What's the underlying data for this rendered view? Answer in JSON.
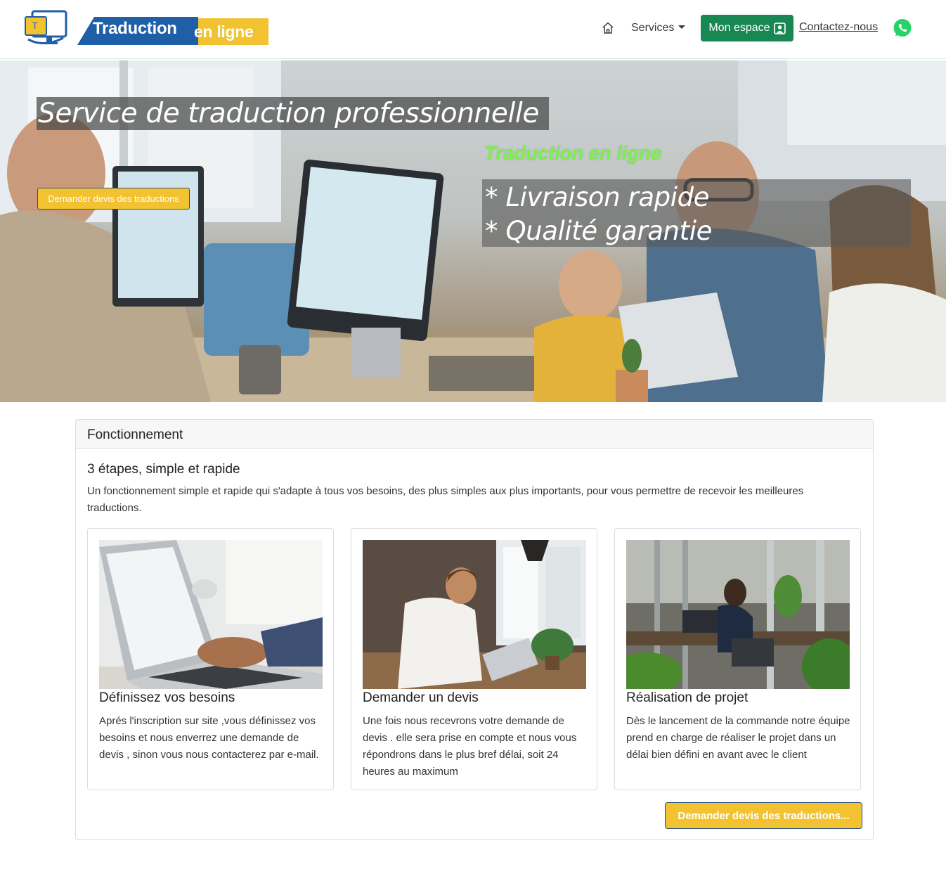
{
  "header": {
    "logo": {
      "text_main": "Traduction",
      "text_accent": "en ligne"
    },
    "nav": {
      "home_icon": "home-icon",
      "services_label": "Services",
      "espace_label": "Mon espace",
      "espace_icon": "user-square-icon",
      "contact_label": "Contactez-nous",
      "whatsapp_icon": "whatsapp-icon"
    }
  },
  "hero": {
    "title": "Service de traduction professionnelle",
    "button_label": "Demander devis des traductions",
    "subtitle": "Traduction en ligne",
    "features": [
      "* Livraison rapide",
      "* Qualité garantie"
    ]
  },
  "main": {
    "card_header": "Fonctionnement",
    "section_title": "3 étapes, simple et rapide",
    "section_description": "Un fonctionnement simple et rapide qui s'adapte à tous vos besoins, des plus simples aux plus importants, pour vous permettre de recevoir les meilleures traductions.",
    "steps": [
      {
        "title": "Définissez vos besoins",
        "text": "Aprés l'inscription sur site ,vous définissez vos besoins et nous enverrez une demande de devis , sinon vous nous contacterez par e-mail."
      },
      {
        "title": "Demander un devis",
        "text": "Une fois nous recevrons votre demande de devis . elle sera prise en compte et nous vous répondrons dans le plus bref délai, soit 24 heures au maximum"
      },
      {
        "title": "Réalisation de projet",
        "text": "Dès le lancement de la commande notre équipe prend en charge de réaliser le projet dans un délai bien défini en avant avec le client"
      }
    ],
    "cta_label": "Demander devis des traductions..."
  },
  "colors": {
    "brand_blue": "#1f5fa8",
    "brand_yellow": "#f2c230",
    "success_green": "#198754",
    "hero_accent_green": "#7cf04c"
  }
}
